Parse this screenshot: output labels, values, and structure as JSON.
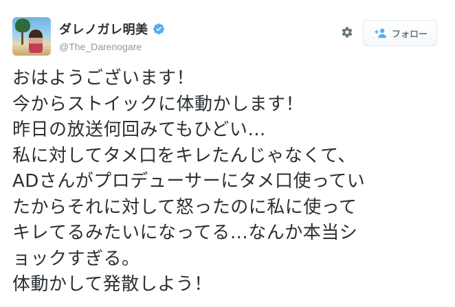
{
  "user": {
    "display_name": "ダレノガレ明美",
    "handle": "@The_Darenogare",
    "verified": true
  },
  "actions": {
    "follow_label": "フォロー",
    "follow_icon": "add-user-icon",
    "settings_icon": "gear-icon"
  },
  "tweet": {
    "lines": [
      "おはようございます！",
      "今からストイックに体動かします！",
      "昨日の放送何回みてもひどい…",
      "私に対してタメ口をキレたんじゃなくて、",
      "ADさんがプロデューサーにタメ口使ってい",
      "たからそれに対して怒ったのに私に使って",
      "キレてるみたいになってる…なんか本当シ",
      "ョックすぎる。",
      "体動かして発散しよう！"
    ]
  },
  "colors": {
    "text": "#292f33",
    "muted": "#8899a6",
    "verified_blue": "#55acee",
    "button_border": "#e1e8ed",
    "button_text": "#66757f"
  }
}
